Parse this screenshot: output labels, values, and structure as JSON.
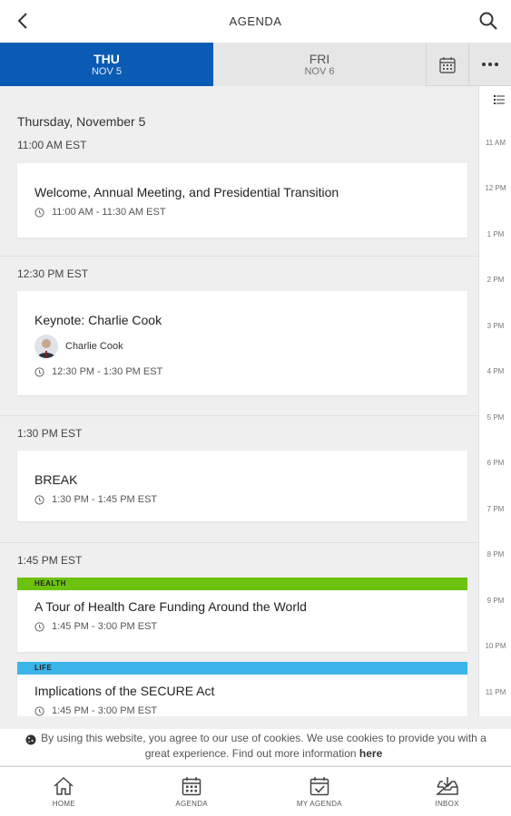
{
  "header": {
    "title": "AGENDA"
  },
  "day_tabs": [
    {
      "day": "THU",
      "date": "NOV 5"
    },
    {
      "day": "FRI",
      "date": "NOV 6"
    }
  ],
  "content": {
    "date_heading": "Thursday, November 5",
    "groups": [
      {
        "time": "11:00 AM EST",
        "sessions": [
          {
            "title": "Welcome, Annual Meeting, and Presidential Transition",
            "time": "11:00 AM - 11:30 AM EST"
          }
        ]
      },
      {
        "time": "12:30 PM EST",
        "sessions": [
          {
            "title": "Keynote: Charlie Cook",
            "speaker": "Charlie Cook",
            "time": "12:30 PM - 1:30 PM EST"
          }
        ]
      },
      {
        "time": "1:30 PM EST",
        "sessions": [
          {
            "title": "BREAK",
            "time": "1:30 PM - 1:45 PM EST"
          }
        ]
      },
      {
        "time": "1:45 PM EST",
        "sessions": [
          {
            "tag": "HEALTH",
            "tag_color": "#6cc20f",
            "title": "A Tour of Health Care Funding Around the World",
            "time": "1:45 PM - 3:00 PM EST"
          },
          {
            "tag": "LIFE",
            "tag_color": "#3bb4e8",
            "title": "Implications of the SECURE Act",
            "time": "1:45 PM - 3:00 PM EST"
          }
        ]
      }
    ]
  },
  "timeline": [
    "11 AM",
    "12 PM",
    "1 PM",
    "2 PM",
    "3 PM",
    "4 PM",
    "5 PM",
    "6 PM",
    "7 PM",
    "8 PM",
    "9 PM",
    "10 PM",
    "11 PM"
  ],
  "cookie": {
    "text": "By using this website, you agree to our use of cookies. We use cookies to provide you with a great experience. Find out more information",
    "link": "here"
  },
  "bottom_nav": [
    {
      "label": "HOME",
      "icon": "home-icon"
    },
    {
      "label": "AGENDA",
      "icon": "calendar-icon"
    },
    {
      "label": "MY AGENDA",
      "icon": "calendar-check-icon"
    },
    {
      "label": "INBOX",
      "icon": "inbox-icon"
    }
  ],
  "colors": {
    "accent": "#0a5bb4",
    "health": "#6cc20f",
    "life": "#3bb4e8"
  }
}
